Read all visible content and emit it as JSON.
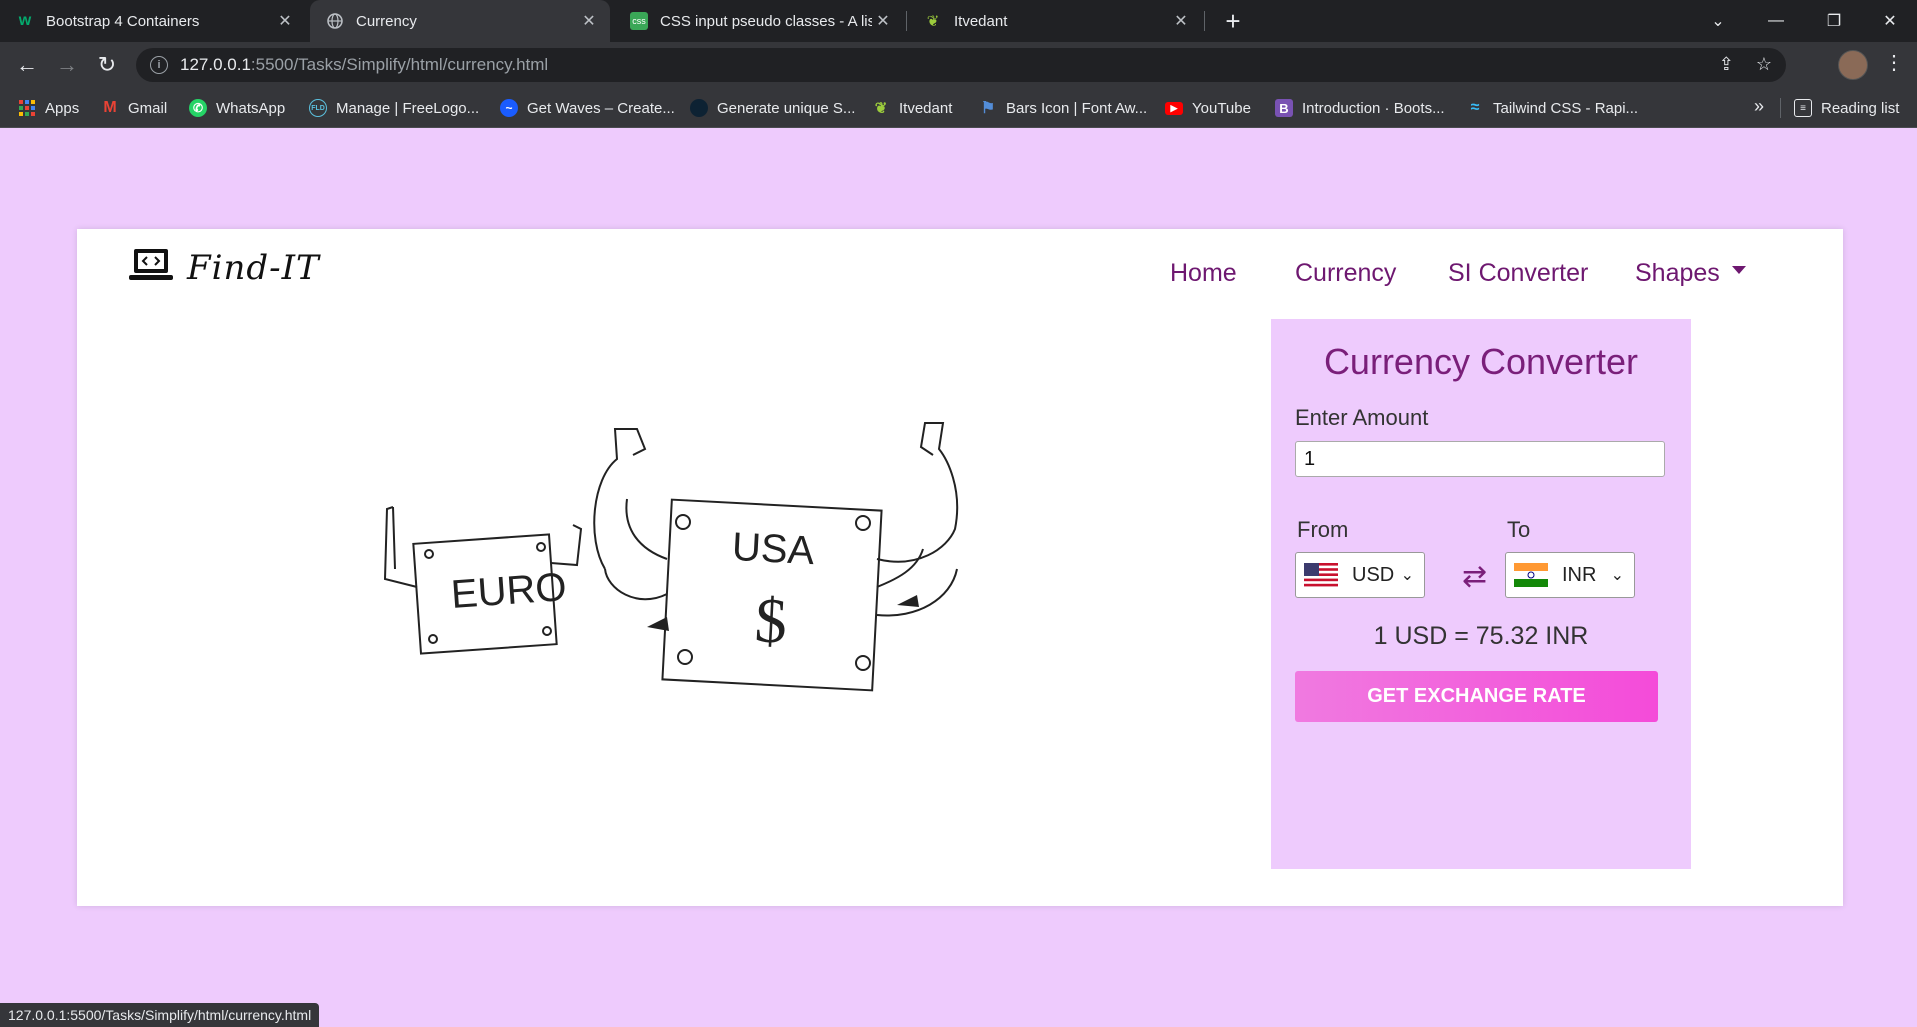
{
  "browser": {
    "tabs": [
      {
        "title": "Bootstrap 4 Containers",
        "icon": "w3schools-icon"
      },
      {
        "title": "Currency",
        "icon": "globe-icon"
      },
      {
        "title": "CSS input pseudo classes - A list",
        "icon": "css-icon"
      },
      {
        "title": "Itvedant",
        "icon": "butterfly-icon"
      }
    ],
    "url_host": "127.0.0.1",
    "url_path": ":5500/Tasks/Simplify/html/currency.html",
    "bookmarks": [
      {
        "label": "Apps",
        "icon": "apps-grid-icon"
      },
      {
        "label": "Gmail",
        "icon": "gmail-icon"
      },
      {
        "label": "WhatsApp",
        "icon": "whatsapp-icon"
      },
      {
        "label": "Manage | FreeLogo...",
        "icon": "freelogo-icon"
      },
      {
        "label": "Get Waves – Create...",
        "icon": "waves-icon"
      },
      {
        "label": "Generate unique S...",
        "icon": "dot-icon"
      },
      {
        "label": "Itvedant",
        "icon": "butterfly-icon"
      },
      {
        "label": "Bars Icon | Font Aw...",
        "icon": "flag-icon"
      },
      {
        "label": "YouTube",
        "icon": "youtube-icon"
      },
      {
        "label": "Introduction · Boots...",
        "icon": "bootstrap-icon"
      },
      {
        "label": "Tailwind CSS - Rapi...",
        "icon": "tailwind-icon"
      }
    ],
    "reading_list": "Reading list",
    "status_url": "127.0.0.1:5500/Tasks/Simplify/html/currency.html"
  },
  "site": {
    "brand": "Find-IT",
    "nav": {
      "home": "Home",
      "currency": "Currency",
      "si": "SI Converter",
      "shapes": "Shapes"
    },
    "illustration": {
      "left_note": "EURO",
      "right_note": "USA",
      "symbol": "$"
    }
  },
  "converter": {
    "title": "Currency Converter",
    "amount_label": "Enter Amount",
    "amount_value": "1",
    "from_label": "From",
    "to_label": "To",
    "from_currency": "USD",
    "to_currency": "INR",
    "result": "1 USD = 75.32 INR",
    "button": "GET EXCHANGE RATE"
  },
  "colors": {
    "page_bg": "#eecbfd",
    "accent": "#7a1f7a",
    "button": "#f44bd9"
  }
}
